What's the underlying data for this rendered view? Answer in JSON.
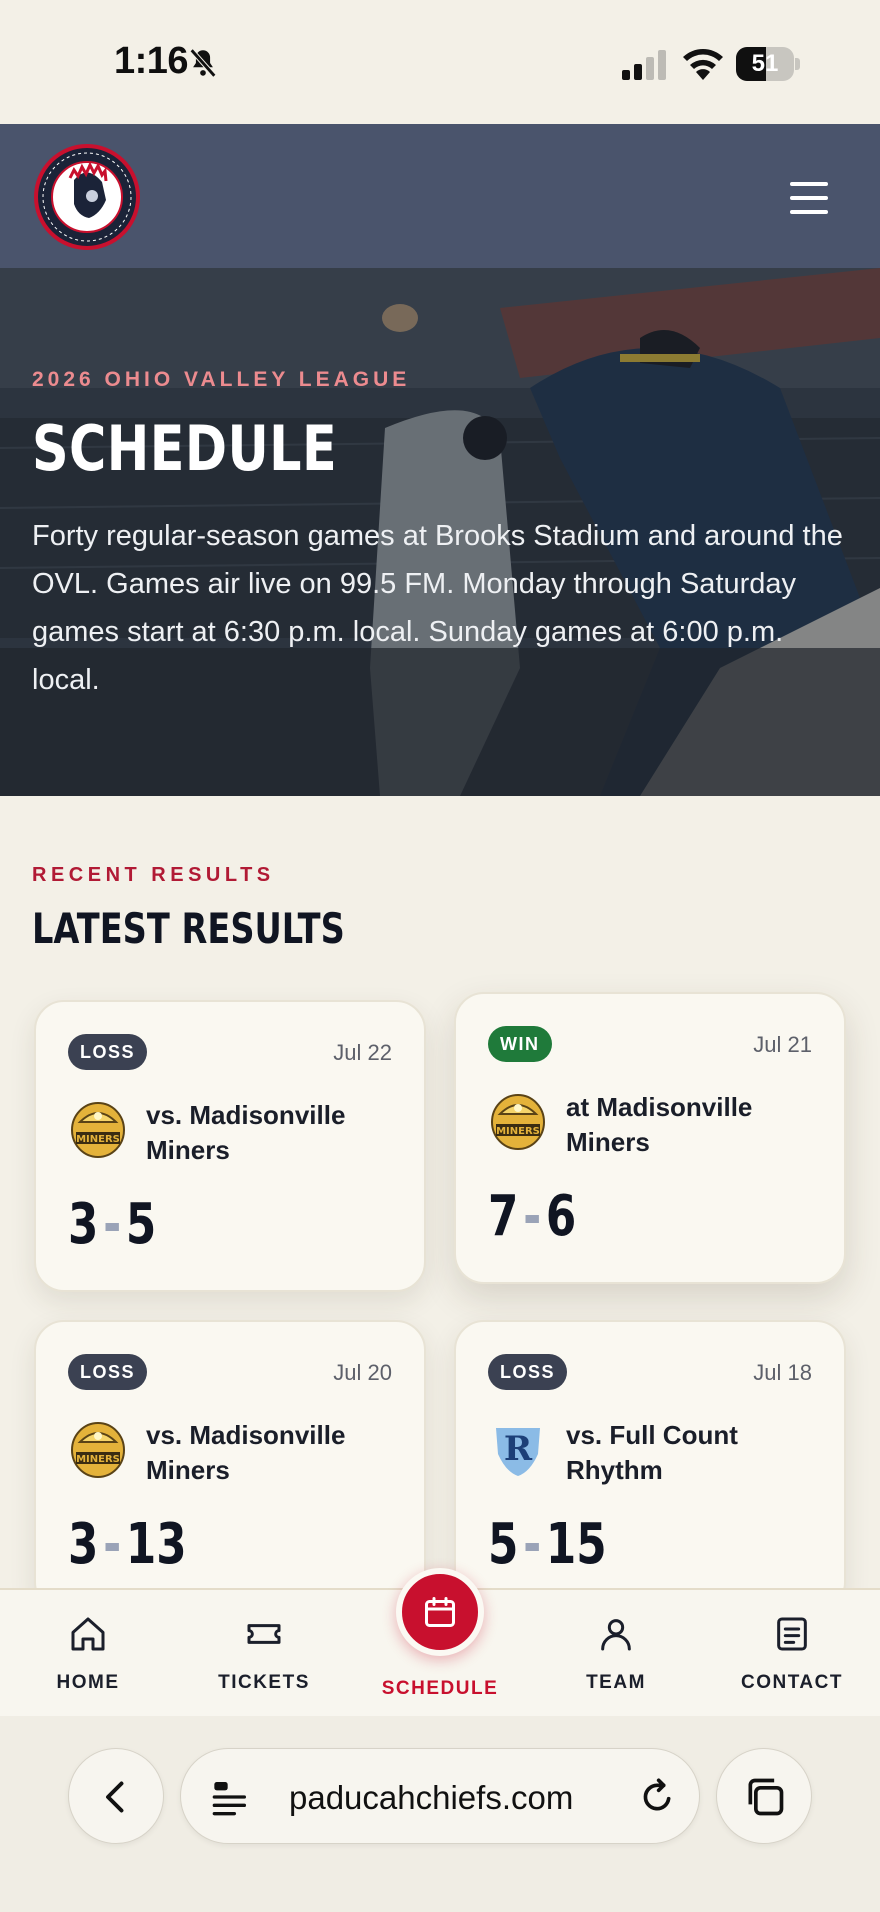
{
  "status_bar": {
    "time": "1:16",
    "battery": "51",
    "battery_level": 0.51
  },
  "header": {
    "logo_alt": "Paducah Chiefs Baseball Club"
  },
  "hero": {
    "eyebrow": "2026 OHIO VALLEY LEAGUE",
    "title": "SCHEDULE",
    "description": "Forty regular-season games at Brooks Stadium and around the OVL. Games air live on 99.5 FM. Monday through Saturday games start at 6:30 p.m. local. Sunday games at 6:00 p.m. local."
  },
  "results": {
    "eyebrow": "RECENT RESULTS",
    "title": "LATEST RESULTS",
    "cards": [
      {
        "result": "LOSS",
        "date": "Jul 22",
        "opponent": "vs. Madisonville Miners",
        "logo": "miners-logo",
        "our_score": "3",
        "their_score": "5"
      },
      {
        "result": "WIN",
        "date": "Jul 21",
        "opponent": "at Madisonville Miners",
        "logo": "miners-logo",
        "our_score": "7",
        "their_score": "6"
      },
      {
        "result": "LOSS",
        "date": "Jul 20",
        "opponent": "vs. Madisonville Miners",
        "logo": "miners-logo",
        "our_score": "3",
        "their_score": "13"
      },
      {
        "result": "LOSS",
        "date": "Jul 18",
        "opponent": "vs. Full Count Rhythm",
        "logo": "rhythm-logo",
        "our_score": "5",
        "their_score": "15"
      }
    ]
  },
  "nav": {
    "items": [
      {
        "label": "HOME",
        "icon": "home-icon"
      },
      {
        "label": "TICKETS",
        "icon": "ticket-icon"
      },
      {
        "label": "SCHEDULE",
        "icon": "calendar-icon",
        "active": true
      },
      {
        "label": "TEAM",
        "icon": "person-icon"
      },
      {
        "label": "CONTACT",
        "icon": "document-icon"
      }
    ]
  },
  "browser": {
    "url": "paducahchiefs.com"
  },
  "colors": {
    "accent": "#c8102e",
    "header": "#4a546c",
    "win": "#1f7a3a",
    "loss": "#3b4152",
    "background": "#f3f0e7"
  }
}
